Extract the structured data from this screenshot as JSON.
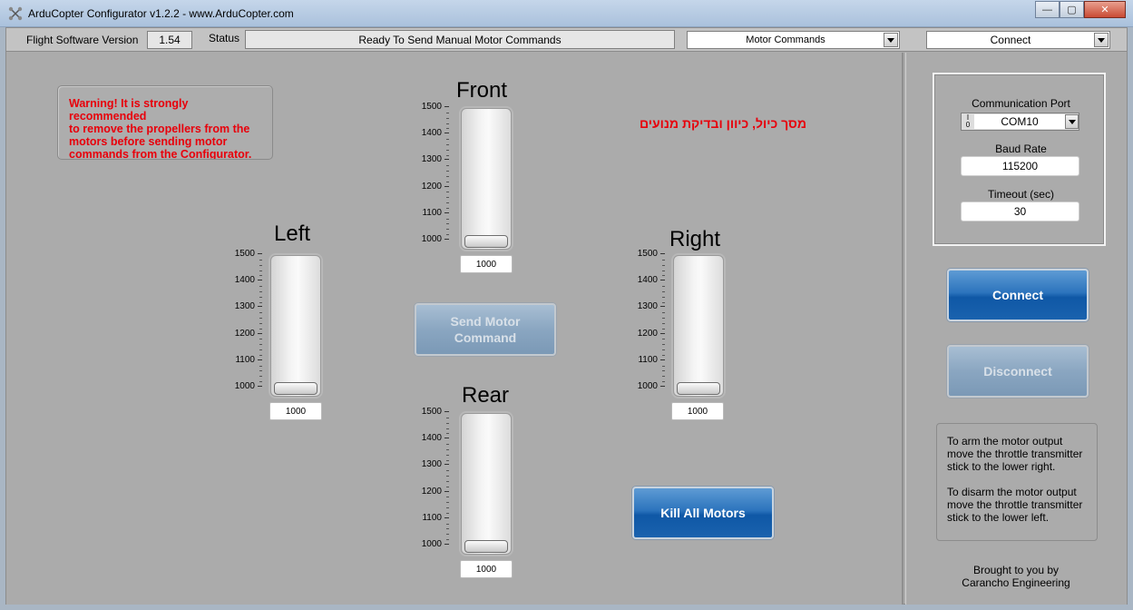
{
  "window": {
    "title": "ArduCopter Configurator v1.2.2 - www.ArduCopter.com",
    "minimize": "—",
    "maximize": "▢",
    "close": "✕"
  },
  "topbar": {
    "fw_label": "Flight Software Version",
    "fw_value": "1.54",
    "status_label": "Status",
    "status_value": "Ready To Send Manual Motor Commands",
    "mode_select": "Motor Commands",
    "connect_select": "Connect"
  },
  "main": {
    "warning": [
      "Warning!  It is strongly",
      "recommended",
      "to remove the propellers from the",
      "motors before sending motor",
      "commands from the Configurator."
    ],
    "hebrew_note": "מסך כיול, כיוון ובדיקת מנועים",
    "send_button": [
      "Send Motor",
      "Command"
    ],
    "kill_button": "Kill All Motors",
    "scale_ticks": [
      "1500",
      "1400",
      "1300",
      "1200",
      "1100",
      "1000"
    ],
    "motors": {
      "front": {
        "label": "Front",
        "value": "1000"
      },
      "left": {
        "label": "Left",
        "value": "1000"
      },
      "right": {
        "label": "Right",
        "value": "1000"
      },
      "rear": {
        "label": "Rear",
        "value": "1000"
      }
    }
  },
  "side": {
    "port_label": "Communication Port",
    "port_value": "COM10",
    "baud_label": "Baud Rate",
    "baud_value": "115200",
    "timeout_label": "Timeout (sec)",
    "timeout_value": "30",
    "connect_button": "Connect",
    "disconnect_button": "Disconnect",
    "info": [
      [
        "To arm the motor output",
        "move the throttle transmitter",
        "stick to the lower right."
      ],
      [
        "To disarm the motor output",
        "move the throttle transmitter",
        "stick to the lower left."
      ]
    ],
    "credit": [
      "Brought to you by",
      "Carancho Engineering"
    ]
  }
}
